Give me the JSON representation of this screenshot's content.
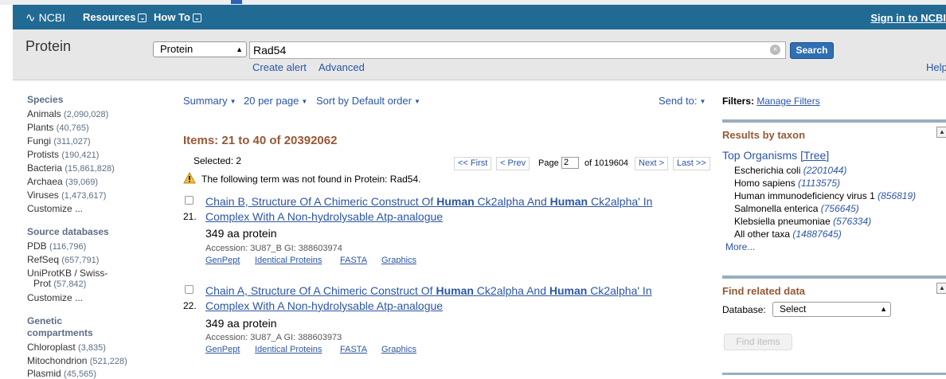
{
  "colors": {
    "header_bg": "#216a94",
    "link": "#2b55a8",
    "accent_brown": "#985735",
    "search_button": "#2f6fb5"
  },
  "header": {
    "logo": "NCBI",
    "menus": [
      "Resources",
      "How To"
    ],
    "signin": "Sign in to NCBI"
  },
  "search": {
    "db_label": "Protein",
    "db_select": "Protein",
    "query": "Rad54",
    "button": "Search",
    "create_alert": "Create alert",
    "advanced": "Advanced",
    "help": "Help"
  },
  "sidebar": {
    "species_title": "Species",
    "species": [
      {
        "label": "Animals",
        "count": "(2,090,028)"
      },
      {
        "label": "Plants",
        "count": "(40,765)"
      },
      {
        "label": "Fungi",
        "count": "(311,027)"
      },
      {
        "label": "Protists",
        "count": "(190,421)"
      },
      {
        "label": "Bacteria",
        "count": "(15,861,828)"
      },
      {
        "label": "Archaea",
        "count": "(39,069)"
      },
      {
        "label": "Viruses",
        "count": "(1,473,617)"
      }
    ],
    "customize": "Customize ...",
    "source_title": "Source databases",
    "sources": [
      {
        "label": "PDB",
        "count": "(116,796)"
      },
      {
        "label": "RefSeq",
        "count": "(657,791)"
      },
      {
        "label": "UniProtKB / Swiss-",
        "count": ""
      },
      {
        "label": "Prot",
        "count": "(57,842)"
      }
    ],
    "genetic_title_1": "Genetic",
    "genetic_title_2": "compartments",
    "genetic": [
      {
        "label": "Chloroplast",
        "count": "(3,835)"
      },
      {
        "label": "Mitochondrion",
        "count": "(521,228)"
      },
      {
        "label": "Plasmid",
        "count": "(45,565)"
      }
    ]
  },
  "toolbar": {
    "summary": "Summary",
    "per_page": "20 per page",
    "sort": "Sort by Default order",
    "send_to": "Send to:"
  },
  "results": {
    "items_title": "Items: 21 to 40 of 20392062",
    "selected": "Selected: 2",
    "pager": {
      "first": "<< First",
      "prev": "< Prev",
      "page_label": "Page",
      "page": "2",
      "of": "of 1019604",
      "next": "Next >",
      "last": "Last >>"
    },
    "warning": "The following term was not found in Protein: Rad54.",
    "items": [
      {
        "num": "21.",
        "title_a": "Chain B, Structure Of A Chimeric Construct Of ",
        "title_b": "Human",
        "title_c": " Ck2alpha And ",
        "title_d": "Human",
        "title_e": " Ck2alpha' In Complex With A Non-hydrolysable Atp-analogue",
        "desc": "349 aa protein",
        "accession": "Accession: 3U87_B   GI: 388603974",
        "links": [
          "GenPept",
          "Identical Proteins",
          "FASTA",
          "Graphics"
        ]
      },
      {
        "num": "22.",
        "title_a": "Chain A, Structure Of A Chimeric Construct Of ",
        "title_b": "Human",
        "title_c": " Ck2alpha And ",
        "title_d": "Human",
        "title_e": " Ck2alpha' In Complex With A Non-hydrolysable Atp-analogue",
        "desc": "349 aa protein",
        "accession": "Accession: 3U87_A   GI: 388603973",
        "links": [
          "GenPept",
          "Identical Proteins",
          "FASTA",
          "Graphics"
        ]
      }
    ]
  },
  "right": {
    "filters_label": "Filters:",
    "manage_filters": "Manage Filters",
    "results_by_taxon": "Results by taxon",
    "top_organisms": "Top Organisms",
    "tree": "[Tree]",
    "organisms": [
      {
        "name": "Escherichia coli",
        "count": "(2201044)"
      },
      {
        "name": "Homo sapiens",
        "count": "(1113575)"
      },
      {
        "name": "Human immunodeficiency virus 1",
        "count": "(856819)"
      },
      {
        "name": "Salmonella enterica",
        "count": "(756645)"
      },
      {
        "name": "Klebsiella pneumoniae",
        "count": "(576334)"
      },
      {
        "name": "All other taxa",
        "count": "(14887645)"
      }
    ],
    "more": "More...",
    "find_related": "Find related data",
    "database_label": "Database:",
    "database_select": "Select",
    "find_items": "Find items"
  }
}
